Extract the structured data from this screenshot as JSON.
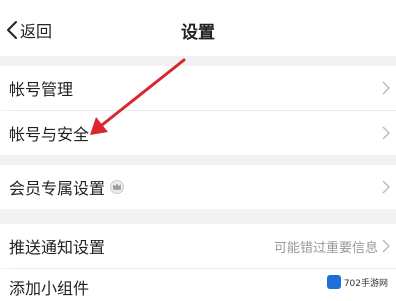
{
  "header": {
    "back_label": "返回",
    "title": "设置"
  },
  "rows": [
    {
      "label": "帐号管理"
    },
    {
      "label": "帐号与安全"
    },
    {
      "label": "会员专属设置"
    },
    {
      "label": "推送通知设置",
      "value": "可能错过重要信息"
    },
    {
      "label": "添加小组件"
    }
  ],
  "watermark": {
    "text": "702手游网"
  },
  "colors": {
    "annotation_arrow": "#d9262f",
    "background": "#f2f2f2",
    "row_background": "#ffffff"
  }
}
